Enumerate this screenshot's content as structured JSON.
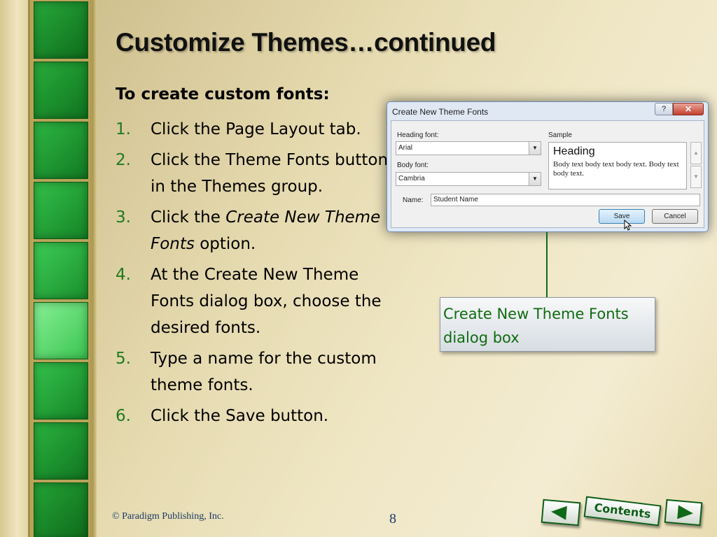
{
  "slide": {
    "title": "Customize Themes…continued",
    "subheading": "To create custom fonts:",
    "steps": [
      {
        "num": "1.",
        "text": "Click the Page Layout tab."
      },
      {
        "num": "2.",
        "text": "Click the Theme Fonts button in the Themes group."
      },
      {
        "num": "3.",
        "text_before": "Click the ",
        "text_italic": "Create New Theme Fonts",
        "text_after": " option."
      },
      {
        "num": "4.",
        "text": "At the Create New Theme Fonts dialog box, choose the desired fonts."
      },
      {
        "num": "5.",
        "text": "Type a name for the custom theme fonts."
      },
      {
        "num": "6.",
        "text": "Click the Save button."
      }
    ],
    "callout": "Create New Theme Fonts dialog box"
  },
  "dialog": {
    "title": "Create New Theme Fonts",
    "help_label": "?",
    "close_label": "✕",
    "heading_font_label": "Heading font:",
    "heading_font_value": "Arial",
    "body_font_label": "Body font:",
    "body_font_value": "Cambria",
    "sample_label": "Sample",
    "sample_heading": "Heading",
    "sample_body": "Body text body text body text. Body text body text.",
    "name_label": "Name:",
    "name_value": "Student Name",
    "save_label": "Save",
    "cancel_label": "Cancel"
  },
  "footer": {
    "copyright": "© Paradigm Publishing, Inc.",
    "page_number": "8",
    "contents_label": "Contents"
  },
  "colors": {
    "accent_green": "#1f7a1f",
    "tile_green": "#1e8f2e",
    "tile_highlight": "#6ee07a",
    "footer_blue": "#1c3a66"
  }
}
